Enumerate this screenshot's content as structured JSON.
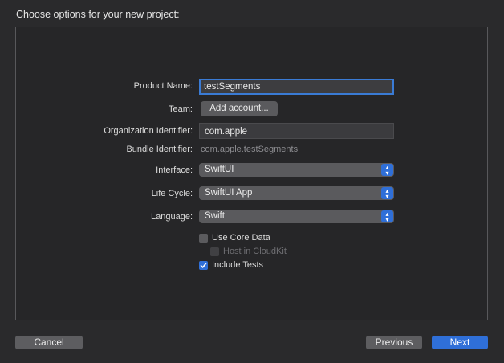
{
  "window": {
    "title": "Choose options for your new project:"
  },
  "form": {
    "product_name": {
      "label": "Product Name:",
      "value": "testSegments"
    },
    "team": {
      "label": "Team:",
      "button": "Add account..."
    },
    "org_identifier": {
      "label": "Organization Identifier:",
      "value": "com.apple"
    },
    "bundle_identifier": {
      "label": "Bundle Identifier:",
      "value": "com.apple.testSegments"
    },
    "interface": {
      "label": "Interface:",
      "value": "SwiftUI"
    },
    "life_cycle": {
      "label": "Life Cycle:",
      "value": "SwiftUI App"
    },
    "language": {
      "label": "Language:",
      "value": "Swift"
    },
    "options": {
      "use_core_data": {
        "label": "Use Core Data",
        "checked": false
      },
      "host_in_cloudkit": {
        "label": "Host in CloudKit",
        "checked": false,
        "enabled": false
      },
      "include_tests": {
        "label": "Include Tests",
        "checked": true
      }
    }
  },
  "footer": {
    "cancel": "Cancel",
    "previous": "Previous",
    "next": "Next"
  },
  "colors": {
    "accent": "#2f6fd8",
    "background": "#2a2a2c",
    "control": "#5a5a5d"
  }
}
